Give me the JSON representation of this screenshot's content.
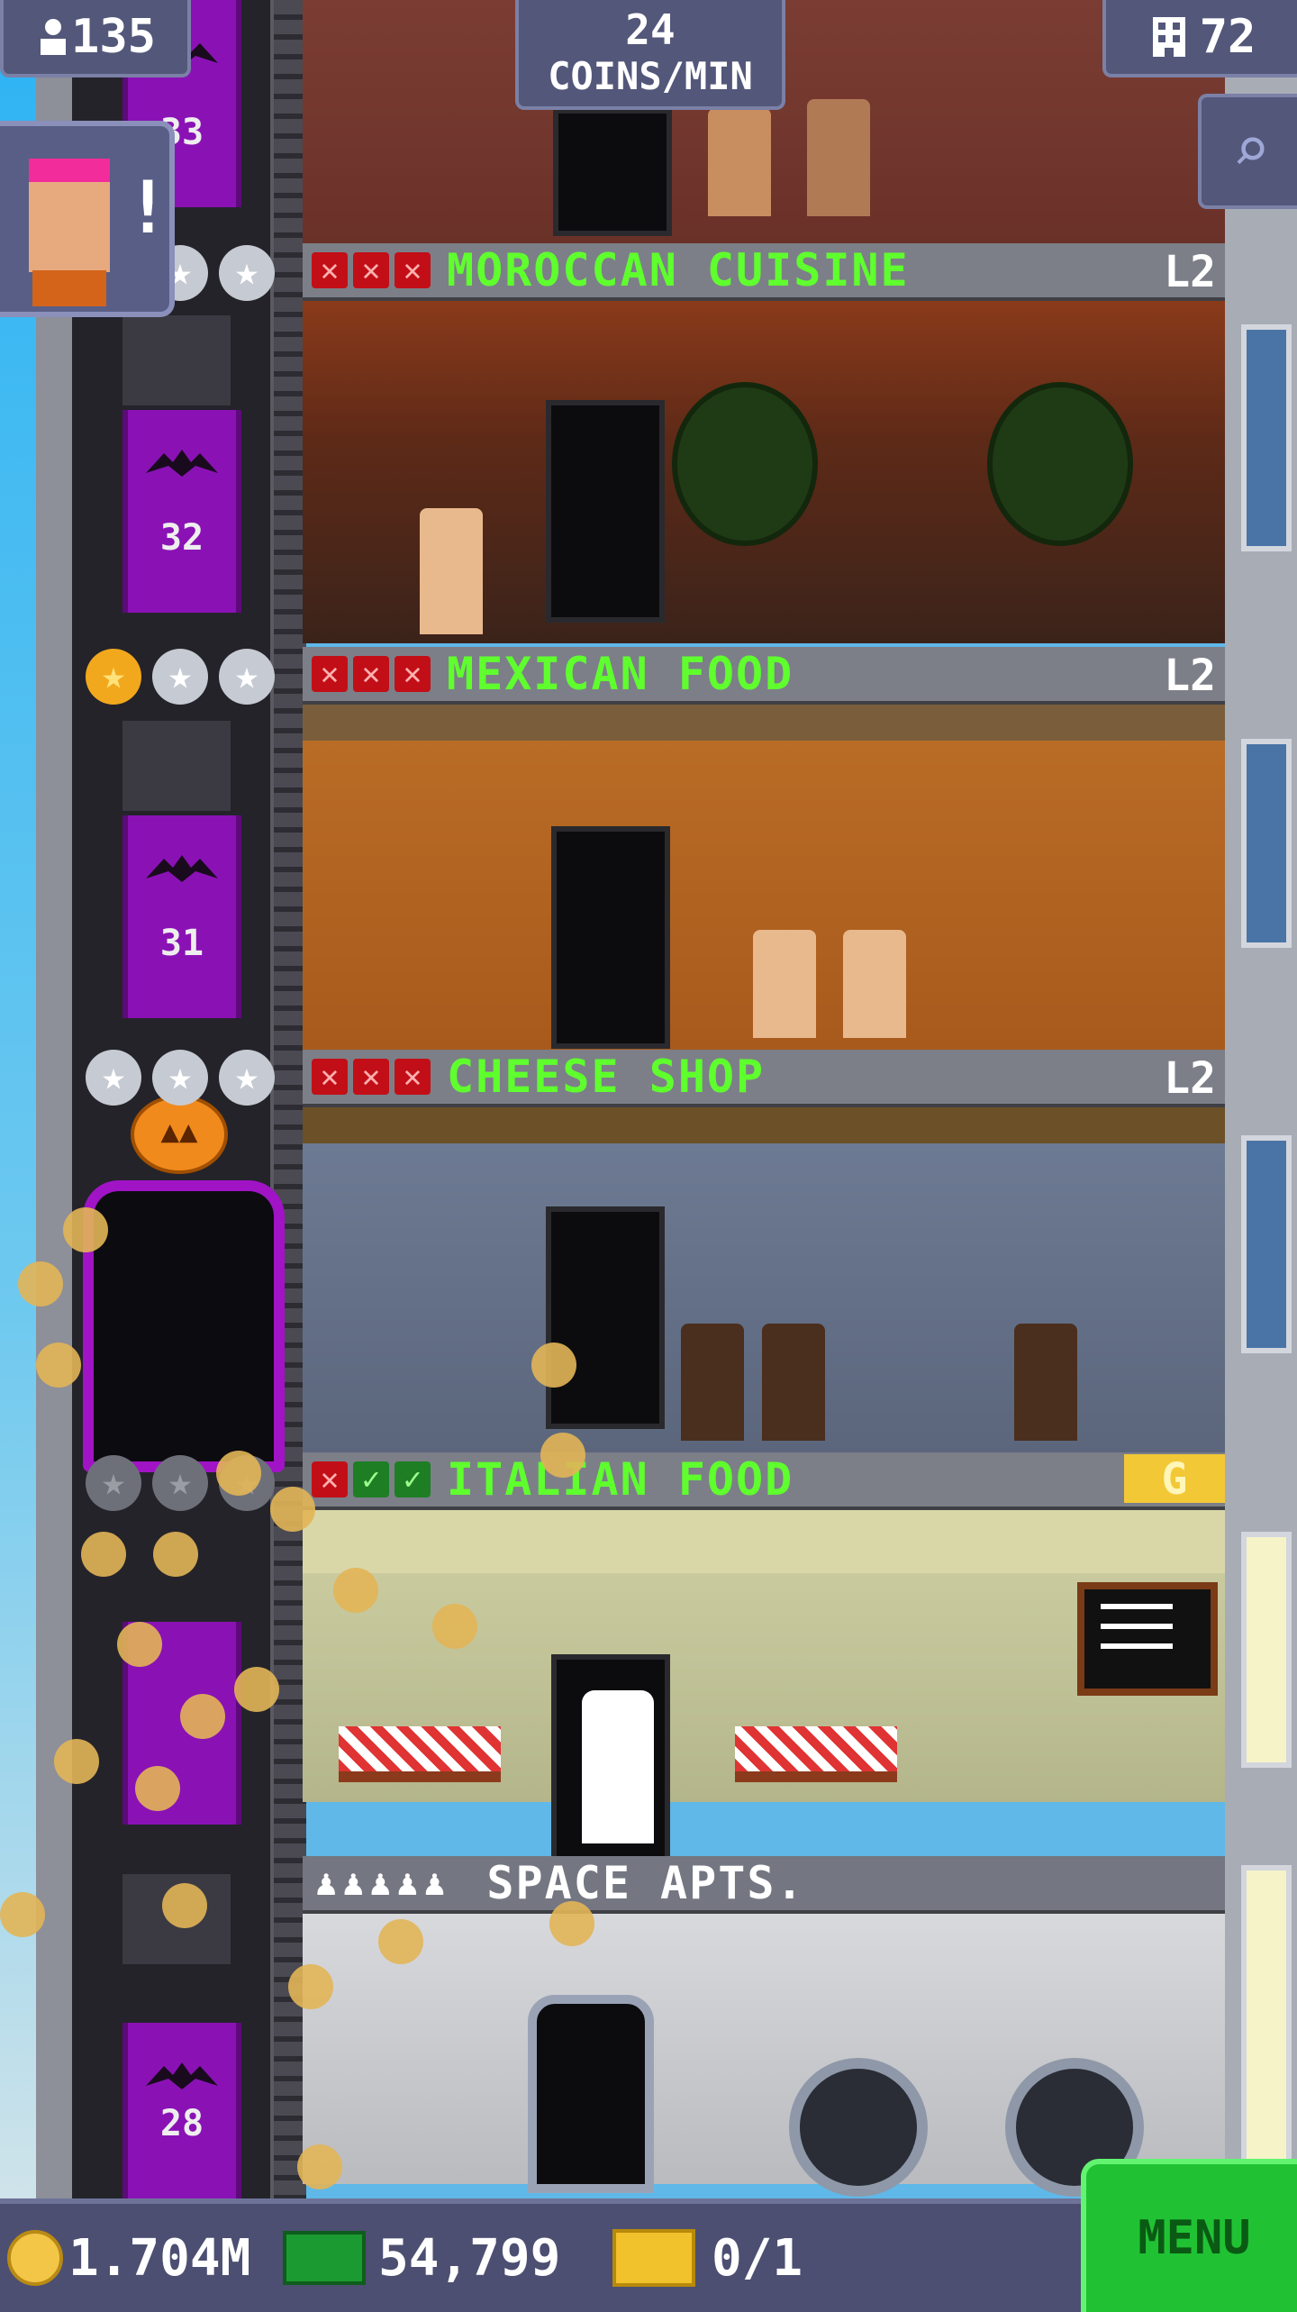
{
  "hud": {
    "population": "135",
    "coins_rate": "24",
    "coins_rate_unit": "COINS/MIN",
    "floor_count": "72",
    "alert_mark": "!"
  },
  "elevator": {
    "floor_numbers": [
      "33",
      "32",
      "31",
      "28"
    ]
  },
  "floors": [
    {
      "name": "MOROCCAN CUISINE",
      "level": "L2",
      "stars_lit": 0
    },
    {
      "name": "MEXICAN FOOD",
      "level": "L2",
      "stars_lit": 1
    },
    {
      "name": "CHEESE SHOP",
      "level": "L2",
      "stars_lit": 0
    },
    {
      "name": "ITALIAN FOOD",
      "level": "G",
      "stars_lit": 0
    },
    {
      "name": "SPACE APTS.",
      "residents_icons": 5
    }
  ],
  "bottom_bar": {
    "coins": "1.704M",
    "bux": "54,799",
    "tickets": "0/1",
    "menu_label": "MENU"
  },
  "colors": {
    "store_name_green": "#5fff2e",
    "elevator_purple": "#8a12b5",
    "menu_green": "#20c234",
    "hud_panel": "#53577a"
  },
  "icons": [
    "person-icon",
    "building-icon",
    "search-icon",
    "star-icon",
    "x-mark-icon",
    "check-mark-icon",
    "coin-icon",
    "bux-icon",
    "ticket-icon",
    "bat-icon",
    "pumpkin-icon"
  ]
}
